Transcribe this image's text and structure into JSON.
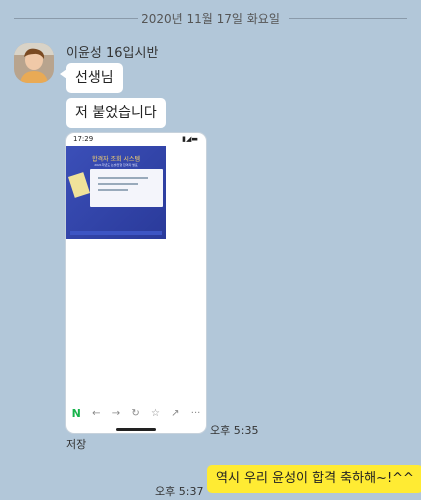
{
  "date_divider": "2020년 11월 17일 화요일",
  "sender": {
    "name": "이윤성 16입시반"
  },
  "messages": [
    {
      "text": "선생님"
    },
    {
      "text": "저 붙었습니다"
    }
  ],
  "photo": {
    "status_time": "17:29",
    "card_title": "합격자 조회 시스템",
    "card_subtitle": "2021학년도 논술전형 합격자 발표"
  },
  "incoming_time": "오후 5:35",
  "save_label": "저장",
  "my_message": {
    "text": "역시 우리 윤성이 합격 축하해~!^^",
    "time": "오후 5:37"
  },
  "colors": {
    "background": "#b2c7d9",
    "my_bubble": "#ffeb33",
    "their_bubble": "#ffffff"
  }
}
